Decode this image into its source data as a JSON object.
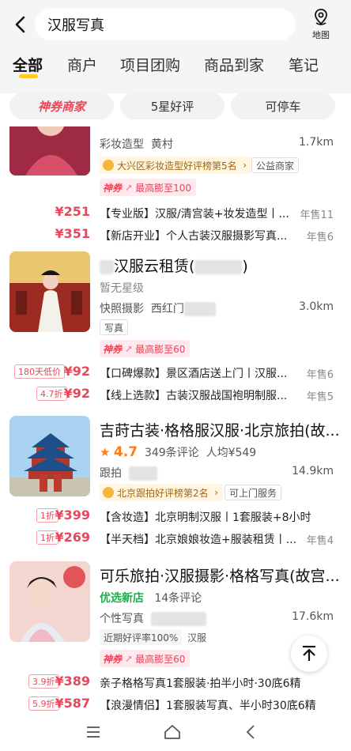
{
  "header": {
    "search_query": "汉服写真",
    "map_label": "地图"
  },
  "tabs": [
    {
      "label": "全部",
      "active": true
    },
    {
      "label": "商户"
    },
    {
      "label": "项目团购"
    },
    {
      "label": "商品到家"
    },
    {
      "label": "笔记"
    }
  ],
  "filters": [
    {
      "label": "神券商家"
    },
    {
      "label": "5星好评"
    },
    {
      "label": "可停车"
    }
  ],
  "colors": {
    "accent": "#ffcc22",
    "price": "#e8465a",
    "rating": "#ff7a1a",
    "green": "#1ab04b"
  },
  "listings": [
    {
      "category": "彩妆造型",
      "area": "黄村",
      "distance": "1.7km",
      "rank_badge": "大兴区彩妆造型好评榜第5名",
      "tag": "公益商家",
      "promo_logo": "神券",
      "promo_text": "最高膨至100",
      "deals": [
        {
          "price": "¥251",
          "title": "【专业版】汉服/清宫装+妆发造型丨...",
          "sold": "年售11"
        },
        {
          "price": "¥351",
          "title": "【新店开业】个人古装汉服摄影写真...",
          "sold": "年售6"
        }
      ]
    },
    {
      "title": "汉服云租赁(",
      "title_end": ")",
      "rating_text": "暂无星级",
      "category": "快照摄影",
      "area": "西红门",
      "distance": "3.0km",
      "tag": "写真",
      "promo_logo": "神券",
      "promo_text": "最高膨至60",
      "deals": [
        {
          "discount": "180天低价",
          "price": "¥92",
          "title": "【口碑爆款】景区酒店送上门丨汉服...",
          "sold": "年售6"
        },
        {
          "discount": "4.7折",
          "price": "¥92",
          "title": "【线上选款】古装汉服战国袍明制服...",
          "sold": "年售5"
        }
      ]
    },
    {
      "title": "吉莳古装·格格服汉服·北京旅拍(故...",
      "rating": "4.7",
      "reviews": "349条评论",
      "avg_price": "人均¥549",
      "category": "跟拍",
      "distance": "14.9km",
      "rank_badge": "北京跟拍好评榜第2名",
      "tag": "可上门服务",
      "deals": [
        {
          "discount": "1折",
          "price": "¥399",
          "title": "【含妆造】北京明制汉服丨1套服装+8小时",
          "sold": ""
        },
        {
          "discount": "1折",
          "price": "¥269",
          "title": "【半天档】北京娘娘妆造+服装租赁丨...",
          "sold": "年售4"
        }
      ]
    },
    {
      "title": "可乐旅拍·汉服摄影·格格写真(故宫...",
      "label": "优选新店",
      "reviews": "14条评论",
      "category": "个性写真",
      "distance": "17.6km",
      "tag1": "近期好评率100%",
      "tag2": "汉服",
      "promo_logo": "神券",
      "promo_text": "最高膨至60",
      "deals": [
        {
          "discount": "3.9折",
          "price": "¥389",
          "title": "亲子格格写真1套服装·拍半小时·30底6精",
          "sold": ""
        },
        {
          "discount": "5.9折",
          "price": "¥587",
          "title": "【浪漫情侣】1套服装写真、半小时30底6精",
          "sold": ""
        }
      ]
    }
  ]
}
